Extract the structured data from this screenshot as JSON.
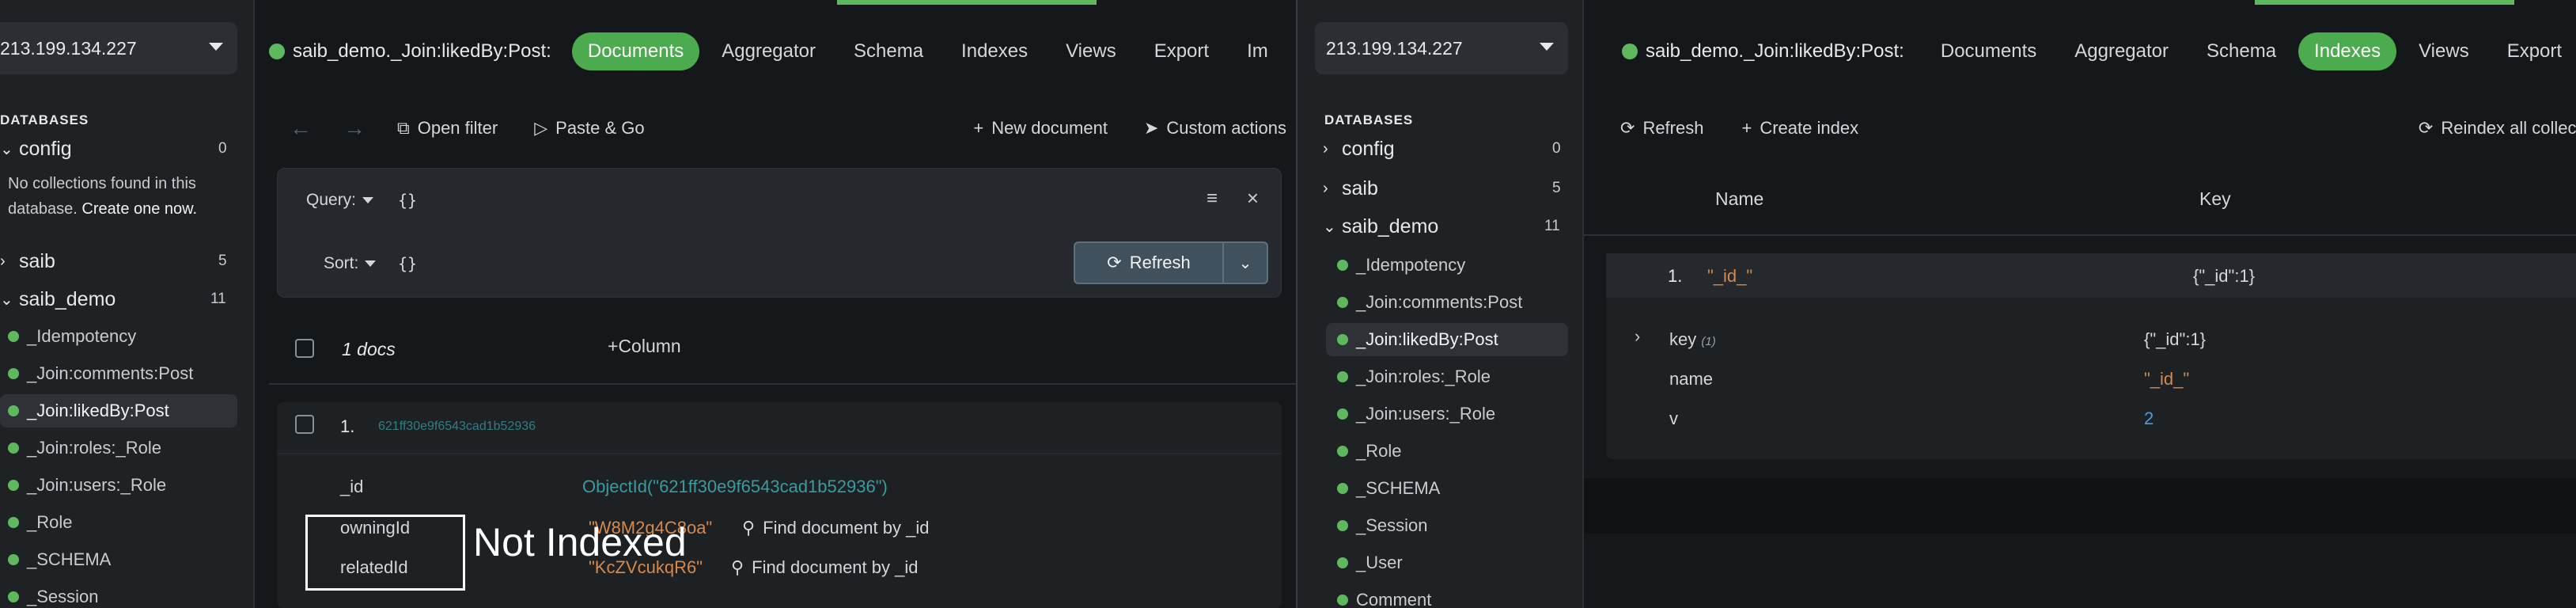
{
  "left": {
    "server": "213.199.134.227",
    "databases_heading": "DATABASES",
    "databases": [
      {
        "name": "config",
        "count": "0"
      },
      {
        "name": "saib",
        "count": "5"
      },
      {
        "name": "saib_demo",
        "count": "11"
      }
    ],
    "empty_note_text": "No collections found in this database.",
    "empty_note_link": "Create one now.",
    "collections": [
      "_Idempotency",
      "_Join:comments:Post",
      "_Join:likedBy:Post",
      "_Join:roles:_Role",
      "_Join:users:_Role",
      "_Role",
      "_SCHEMA",
      "_Session"
    ],
    "tab_title": "saib_demo._Join:likedBy:Post:",
    "tabs": [
      "Documents",
      "Aggregator",
      "Schema",
      "Indexes",
      "Views",
      "Export",
      "Im"
    ],
    "toolbar": {
      "open_filter": "Open filter",
      "paste_go": "Paste & Go",
      "new_document": "New document",
      "custom_actions": "Custom actions"
    },
    "query": {
      "query_label": "Query:",
      "query_value": "{}",
      "sort_label": "Sort:",
      "sort_value": "{}",
      "refresh": "Refresh"
    },
    "docs_count": "1 docs",
    "column_button": "Column",
    "doc": {
      "index": "1.",
      "id_preview": "621ff30e9f6543cad1b52936",
      "fields": [
        {
          "key": "_id",
          "value": "ObjectId(\"621ff30e9f6543cad1b52936\")"
        },
        {
          "key": "owningId",
          "value": "\"W8M2g4C8oa\"",
          "action": "Find document by _id"
        },
        {
          "key": "relatedId",
          "value": "\"KcZVcukqR6\"",
          "action": "Find document by _id"
        }
      ]
    },
    "annotation": "Not Indexed"
  },
  "right": {
    "server": "213.199.134.227",
    "databases_heading": "DATABASES",
    "databases": [
      {
        "name": "config",
        "count": "0"
      },
      {
        "name": "saib",
        "count": "5"
      },
      {
        "name": "saib_demo",
        "count": "11"
      }
    ],
    "collections": [
      "_Idempotency",
      "_Join:comments:Post",
      "_Join:likedBy:Post",
      "_Join:roles:_Role",
      "_Join:users:_Role",
      "_Role",
      "_SCHEMA",
      "_Session",
      "_User",
      "Comment"
    ],
    "tab_title": "saib_demo._Join:likedBy:Post:",
    "tabs": [
      "Documents",
      "Aggregator",
      "Schema",
      "Indexes",
      "Views",
      "Export"
    ],
    "toolbar": {
      "refresh": "Refresh",
      "create_index": "Create index",
      "reindex": "Reindex all collection"
    },
    "columns": {
      "name": "Name",
      "key": "Key"
    },
    "index_row": {
      "index": "1.",
      "name": "\"_id_\"",
      "key": "{\"_id\":1}"
    },
    "details": [
      {
        "label": "key",
        "count": "(1)",
        "value": "{\"_id\":1}"
      },
      {
        "label": "name",
        "value": "\"_id_\""
      },
      {
        "label": "v",
        "value": "2"
      }
    ]
  },
  "colors": {
    "accent_green": "#4caa4f",
    "teal_value": "#3a9aa0",
    "orange_value": "#d6894a",
    "blue_value": "#4d9be0"
  }
}
